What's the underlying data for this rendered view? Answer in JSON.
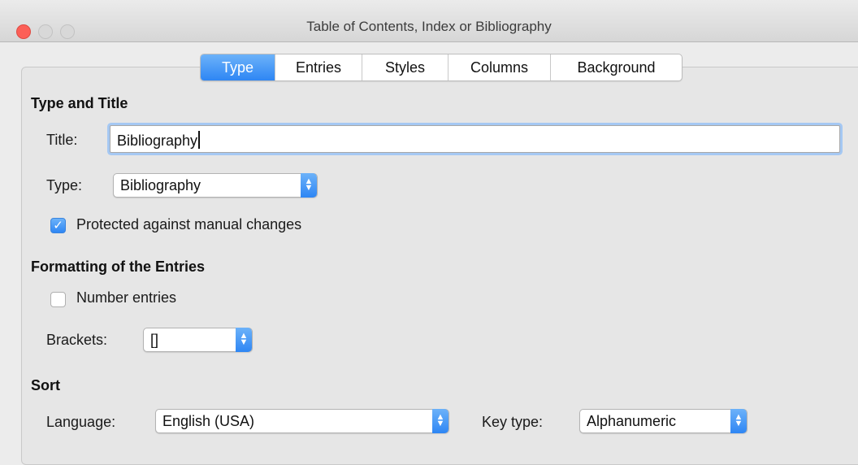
{
  "window": {
    "title": "Table of Contents, Index or Bibliography"
  },
  "tabs": [
    {
      "label": "Type",
      "active": true
    },
    {
      "label": "Entries",
      "active": false
    },
    {
      "label": "Styles",
      "active": false
    },
    {
      "label": "Columns",
      "active": false
    },
    {
      "label": "Background",
      "active": false
    }
  ],
  "type_and_title": {
    "heading": "Type and Title",
    "title_label": "Title:",
    "title_value": "Bibliography",
    "type_label": "Type:",
    "type_value": "Bibliography",
    "protected_label": "Protected against manual changes",
    "protected_checked": true
  },
  "formatting": {
    "heading": "Formatting of the Entries",
    "number_entries_label": "Number entries",
    "number_entries_checked": false,
    "brackets_label": "Brackets:",
    "brackets_value": "[]"
  },
  "sort": {
    "heading": "Sort",
    "language_label": "Language:",
    "language_value": "English (USA)",
    "key_type_label": "Key type:",
    "key_type_value": "Alphanumeric"
  },
  "colors": {
    "accent": "#2e86f4",
    "close_button": "#fc5f57",
    "focus_ring": "#a5c8f3"
  },
  "icons": {
    "checkmark": "checkmark-icon",
    "updown": "chevron-updown-icon"
  }
}
